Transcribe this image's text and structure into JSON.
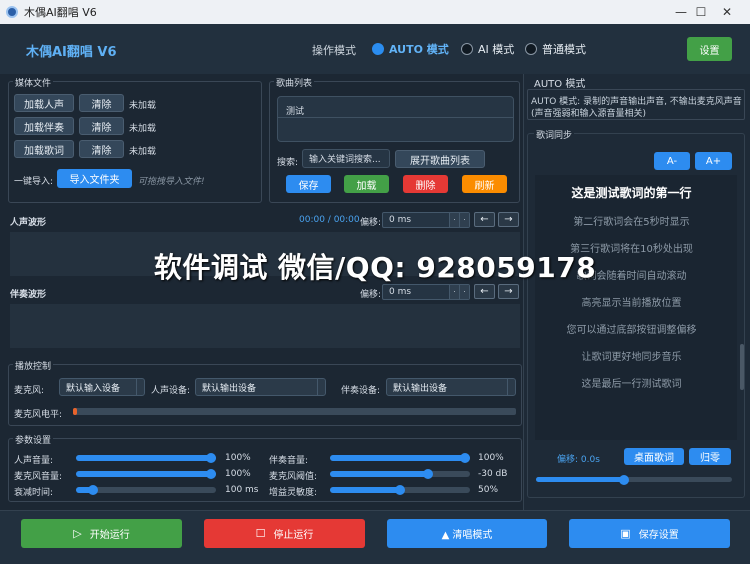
{
  "window": {
    "title": "木偶AI翻唱 V6",
    "minimize": "—",
    "maximize": "☐",
    "close": "✕"
  },
  "header": {
    "app_title": "木偶AI翻唱 V6",
    "mode_label": "操作模式",
    "modes": [
      {
        "label": "AUTO 模式",
        "selected": true
      },
      {
        "label": "AI 模式",
        "selected": false
      },
      {
        "label": "普通模式",
        "selected": false
      }
    ],
    "settings_label": "设置"
  },
  "media": {
    "title": "媒体文件",
    "rows": [
      {
        "load": "加载人声",
        "clear": "清除",
        "status": "未加载"
      },
      {
        "load": "加载伴奏",
        "clear": "清除",
        "status": "未加载"
      },
      {
        "load": "加载歌词",
        "clear": "清除",
        "status": "未加载"
      }
    ],
    "import_label": "一键导入:",
    "import_button": "导入文件夹",
    "import_hint": "可拖拽导入文件!"
  },
  "songlist": {
    "title": "歌曲列表",
    "items": [
      "测试"
    ],
    "search_label": "搜索:",
    "search_placeholder": "输入关键词搜索...",
    "expand_button": "展开歌曲列表",
    "buttons": {
      "save": "保存",
      "load": "加载",
      "delete": "删除",
      "refresh": "刷新"
    }
  },
  "vocal_wave": {
    "title": "人声波形",
    "time": "00:00 / 00:00",
    "offset_label": "偏移:",
    "offset_value": "0 ms",
    "prev": "←",
    "next": "→"
  },
  "accomp_wave": {
    "title": "伴奏波形",
    "offset_label": "偏移:",
    "offset_value": "0 ms",
    "prev": "←",
    "next": "→"
  },
  "playback": {
    "title": "播放控制",
    "mic_label": "麦克风:",
    "mic_value": "默认输入设备",
    "vocal_device_label": "人声设备:",
    "vocal_device_value": "默认输出设备",
    "accomp_device_label": "伴奏设备:",
    "accomp_device_value": "默认输出设备",
    "mic_level_label": "麦克风电平:",
    "mic_level": 0.01
  },
  "params": {
    "title": "参数设置",
    "left": [
      {
        "label": "人声音量:",
        "value": "100%",
        "level": 1.0
      },
      {
        "label": "麦克风音量:",
        "value": "100%",
        "level": 1.0
      },
      {
        "label": "衰减时间:",
        "value": "100 ms",
        "level": 0.12
      }
    ],
    "right": [
      {
        "label": "伴奏音量:",
        "value": "100%",
        "level": 1.0
      },
      {
        "label": "麦克风阈值:",
        "value": "-30 dB",
        "level": 0.7
      },
      {
        "label": "增益灵敏度:",
        "value": "50%",
        "level": 0.5
      }
    ]
  },
  "auto_panel": {
    "title": "AUTO 模式",
    "desc_line1": "AUTO 模式: 录制的声音输出声音, 不输出麦克风声音",
    "desc_line2": "(声音强弱和输入源音量相关)"
  },
  "lyrics": {
    "title": "歌词同步",
    "font_minus": "A-",
    "font_plus": "A+",
    "lines": [
      "这是测试歌词的第一行",
      "第二行歌词会在5秒时显示",
      "第三行歌词将在10秒处出现",
      "歌词会随着时间自动滚动",
      "高亮显示当前播放位置",
      "您可以通过底部按钮调整偏移",
      "让歌词更好地同步音乐",
      "这是最后一行测试歌词"
    ],
    "offset_text": "偏移: 0.0s",
    "desktop_lyrics": "桌面歌词",
    "reset": "归零",
    "offset_level": 0.45
  },
  "footer": {
    "start": "开始运行",
    "stop": "停止运行",
    "clean_mode": "▲ 清唱模式",
    "save_settings": "保存设置"
  },
  "watermark": "软件调试 微信/QQ: 928059178",
  "colors": {
    "accent": "#2d8cf0",
    "green": "#43a047",
    "red": "#e53935",
    "orange": "#fb8c00",
    "background": "#1c2733"
  }
}
